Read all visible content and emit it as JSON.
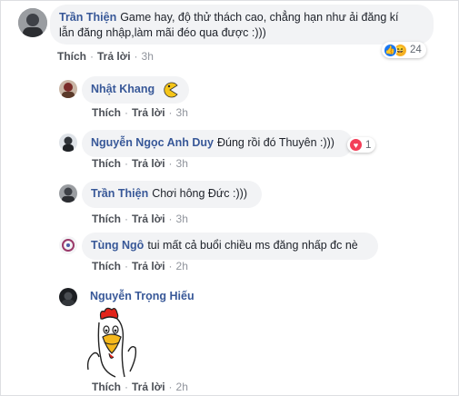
{
  "comments": [
    {
      "name": "Trần Thiện",
      "text": "Game hay, độ thử thách cao, chẳng hạn như ải đăng kí",
      "text2": "lẫn đăng nhập,làm mãi đéo qua được :)))",
      "like": "Thích",
      "reply": "Trả lời",
      "sep": "·",
      "time": "3h",
      "reaction_count": "24"
    },
    {
      "name": "Nhật Khang",
      "like": "Thích",
      "reply": "Trả lời",
      "sep": "·",
      "time": "3h"
    },
    {
      "name": "Nguyễn Ngọc Anh Duy",
      "text": "Đúng rồi đó Thuyên :)))",
      "like": "Thích",
      "reply": "Trả lời",
      "sep": "·",
      "time": "3h",
      "reaction_count": "1"
    },
    {
      "name": "Trần Thiện",
      "text": "Chơi hông Đức :)))",
      "like": "Thích",
      "reply": "Trả lời",
      "sep": "·",
      "time": "3h"
    },
    {
      "name": "Tùng Ngô",
      "text": "tui mất cả buổi chiều ms đăng nhấp đc nè",
      "like": "Thích",
      "reply": "Trả lời",
      "sep": "·",
      "time": "2h"
    },
    {
      "name": "Nguyễn Trọng Hiếu",
      "like": "Thích",
      "reply": "Trả lời",
      "sep": "·",
      "time": "2h"
    }
  ],
  "colors": {
    "name_link": "#385898",
    "bubble_bg": "#f2f3f5",
    "like_blue": "#1877f2",
    "love_red": "#f33e58"
  },
  "icons": [
    "like-reaction-icon",
    "haha-reaction-icon",
    "love-reaction-icon",
    "pacman-sticker-icon",
    "chicken-sticker-icon"
  ]
}
